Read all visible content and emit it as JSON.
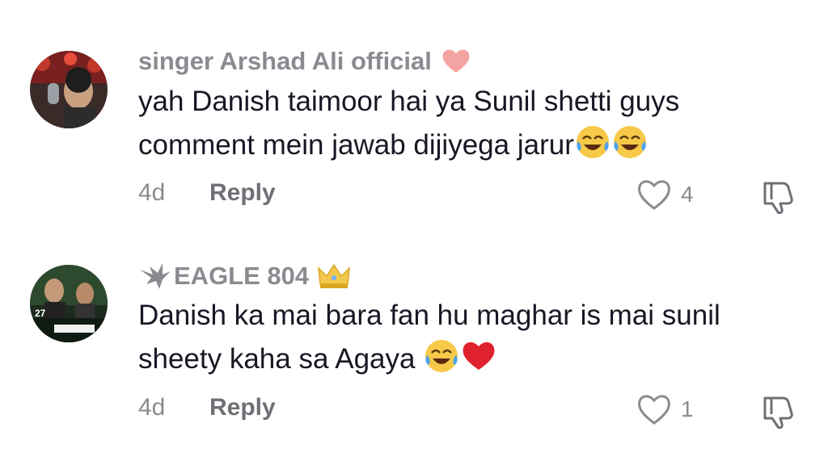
{
  "comments": [
    {
      "username": "singer Arshad Ali official",
      "text": "yah Danish taimoor hai ya Sunil shetti guys comment mein jawab dijiyega jarur",
      "trailing_emojis": [
        "face-with-tears-of-joy",
        "face-with-tears-of-joy"
      ],
      "badge_icon": "heart-icon",
      "age": "4d",
      "reply_label": "Reply",
      "likes": "4"
    },
    {
      "username": "EAGLE 804",
      "prefix_icon": "eagle-icon",
      "badge_icon": "crown-icon",
      "text": "Danish ka mai bara fan hu maghar is mai sunil sheety kaha sa Agaya",
      "trailing_emojis": [
        "face-with-tears-of-joy",
        "red-heart"
      ],
      "avatar_text": "27",
      "age": "4d",
      "reply_label": "Reply",
      "likes": "1"
    }
  ],
  "colors": {
    "primary_text": "#161823",
    "secondary_text": "#8a8b91",
    "heart_badge": "#f4a3a3"
  }
}
